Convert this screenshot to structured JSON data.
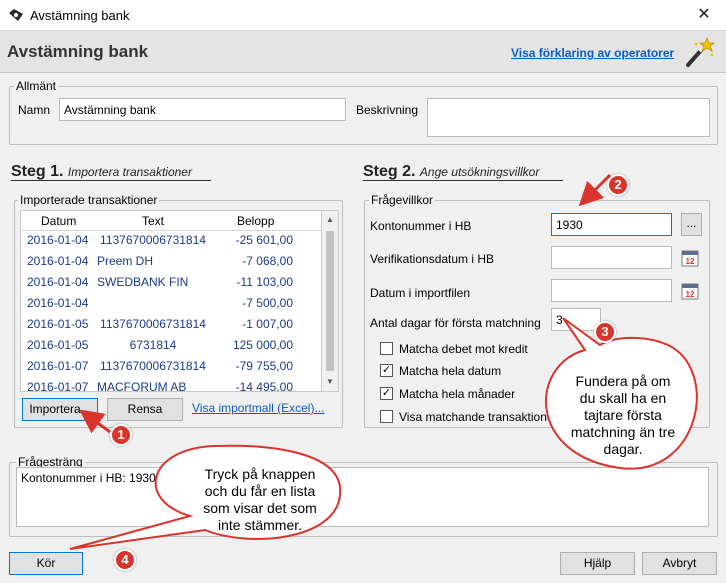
{
  "window": {
    "title": "Avstämning bank",
    "close_glyph": "✕"
  },
  "header": {
    "title": "Avstämning bank",
    "help_link": "Visa förklaring av operatorer"
  },
  "allmant": {
    "legend": "Allmänt",
    "namn_label": "Namn",
    "namn_value": "Avstämning bank",
    "beskrivning_label": "Beskrivning",
    "beskrivning_value": ""
  },
  "steg1": {
    "title": "Steg 1.",
    "subtitle": "Importera transaktioner",
    "group_legend": "Importerade transaktioner",
    "columns": [
      "Datum",
      "Text",
      "Belopp"
    ],
    "rows": [
      {
        "datum": "2016-01-04",
        "text": "1137670006731814",
        "belopp": "-25 601,00"
      },
      {
        "datum": "2016-01-04",
        "text": "Preem DH",
        "belopp": "-7 068,00"
      },
      {
        "datum": "2016-01-04",
        "text": "SWEDBANK FIN",
        "belopp": "-11 103,00"
      },
      {
        "datum": "2016-01-04",
        "text": "",
        "belopp": "-7 500,00"
      },
      {
        "datum": "2016-01-05",
        "text": "1137670006731814",
        "belopp": "-1 007,00"
      },
      {
        "datum": "2016-01-05",
        "text": "6731814",
        "belopp": "125 000,00"
      },
      {
        "datum": "2016-01-07",
        "text": "1137670006731814",
        "belopp": "-79 755,00"
      },
      {
        "datum": "2016-01-07",
        "text": "MACFORUM AB",
        "belopp": "-14 495,00"
      }
    ],
    "importera_button": "Importera...",
    "rensa_button": "Rensa",
    "importmall_link": "Visa importmall (Excel)..."
  },
  "steg2": {
    "title": "Steg 2.",
    "subtitle": "Ange utsökningsvillkor",
    "group_legend": "Frågevillkor",
    "kontonummer_label": "Kontonummer i HB",
    "kontonummer_value": "1930",
    "browse_button": "...",
    "verifikationsdatum_label": "Verifikationsdatum i HB",
    "verifikationsdatum_value": "",
    "datum_import_label": "Datum i importfilen",
    "datum_import_value": "",
    "antal_dagar_label": "Antal dagar för första matchning",
    "antal_dagar_value": "3",
    "calendar_day": "12",
    "checkboxes": [
      {
        "label": "Matcha debet mot kredit",
        "checked": false,
        "mark": ""
      },
      {
        "label": "Matcha hela datum",
        "checked": true,
        "mark": "✓"
      },
      {
        "label": "Matcha hela månader",
        "checked": true,
        "mark": "✓"
      },
      {
        "label": "Visa matchande transaktioner",
        "checked": false,
        "mark": ""
      }
    ]
  },
  "fragestrang": {
    "legend": "Frågesträng",
    "value": "Kontonummer i HB: 1930"
  },
  "footer": {
    "kor_button": "Kör",
    "hjalp_button": "Hjälp",
    "avbryt_button": "Avbryt"
  },
  "annotations": {
    "badge1": "1",
    "badge2": "2",
    "badge3": "3",
    "badge4": "4",
    "bubble1_line1": "Tryck på knappen",
    "bubble1_line2": "och du får en lista",
    "bubble1_line3": "som visar det som",
    "bubble1_line4": "inte stämmer.",
    "bubble2_line1": "Fundera på om",
    "bubble2_line2": "du skall ha en",
    "bubble2_line3": "tajtare första",
    "bubble2_line4": "matchning än tre",
    "bubble2_line5": "dagar.",
    "color": "#d9342b"
  }
}
